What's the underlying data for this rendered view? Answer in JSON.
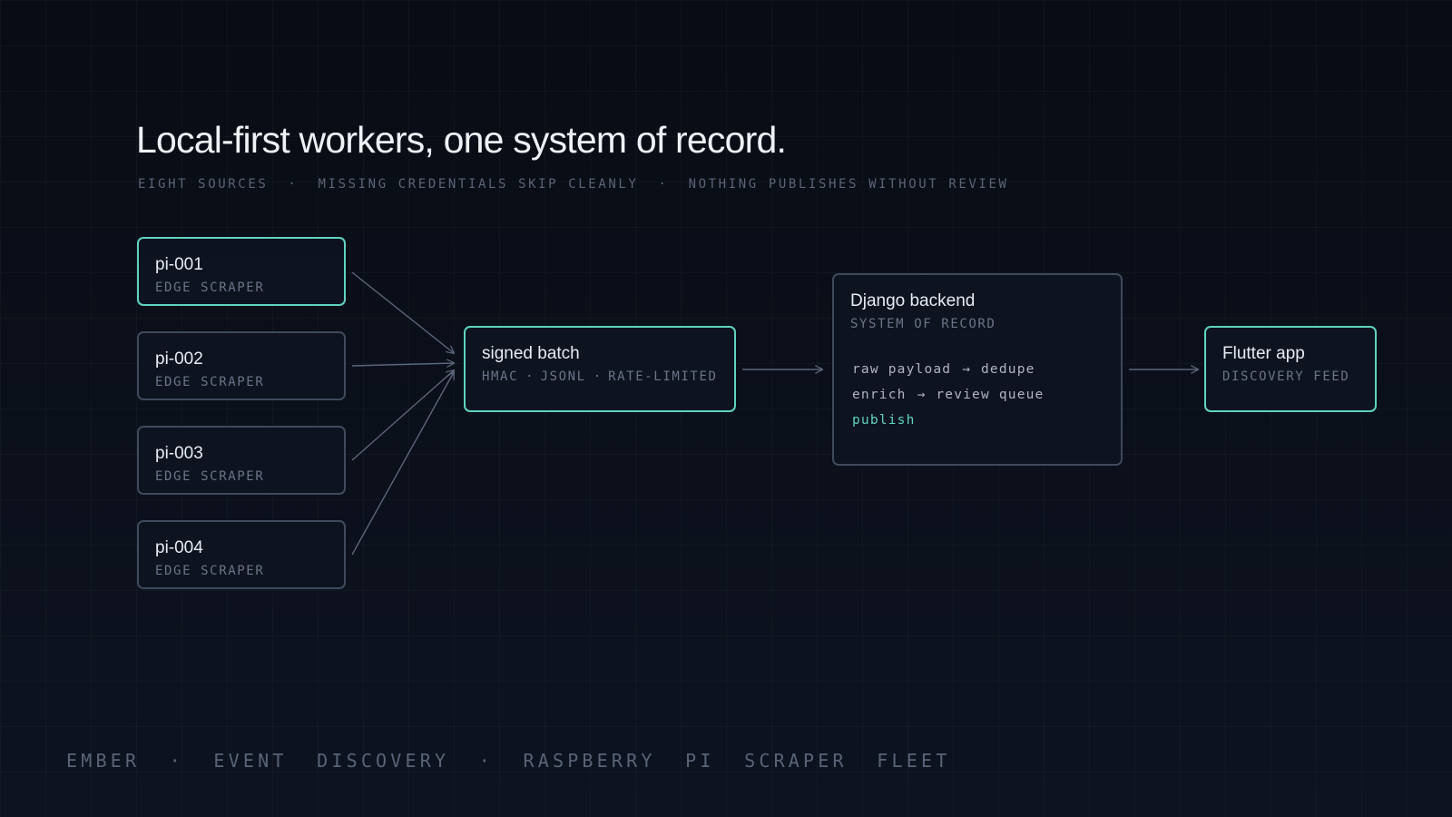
{
  "title": "Local-first workers, one system of record.",
  "subtitle": "EIGHT SOURCES  ·  MISSING CREDENTIALS SKIP CLEANLY  ·  NOTHING PUBLISHES WITHOUT REVIEW",
  "workers": [
    {
      "name": "pi-001",
      "role": "EDGE SCRAPER",
      "highlighted": true
    },
    {
      "name": "pi-002",
      "role": "EDGE SCRAPER",
      "highlighted": false
    },
    {
      "name": "pi-003",
      "role": "EDGE SCRAPER",
      "highlighted": false
    },
    {
      "name": "pi-004",
      "role": "EDGE SCRAPER",
      "highlighted": false
    }
  ],
  "batch": {
    "name": "signed batch",
    "tags": [
      "HMAC",
      "JSONL",
      "RATE-LIMITED"
    ],
    "separator": "·"
  },
  "backend": {
    "name": "Django backend",
    "role": "SYSTEM OF RECORD",
    "arrow": "→",
    "steps": {
      "raw_payload": "raw payload",
      "dedupe": "dedupe",
      "enrich": "enrich",
      "review_queue": "review queue",
      "publish": "publish"
    }
  },
  "app": {
    "name": "Flutter app",
    "role": "DISCOVERY FEED"
  },
  "footer": "EMBER  ·  EVENT  DISCOVERY  ·  RASPBERRY  PI  SCRAPER  FLEET",
  "colors": {
    "accent": "#5fd3bf",
    "node_border": "#3f4a5c",
    "connector": "#5b667a",
    "background": "#0b111b"
  }
}
